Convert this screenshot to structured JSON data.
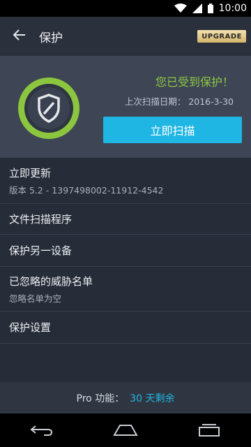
{
  "status_bar": {
    "time": "10:00",
    "icons": [
      "wifi-icon",
      "signal-icon",
      "battery-icon"
    ]
  },
  "app_bar": {
    "title": "保护",
    "upgrade_label": "UPGRADE",
    "back_icon": "back-arrow-icon"
  },
  "hero": {
    "status_title": "您已受到保护！",
    "last_scan": "上次扫描日期： 2016-3-30",
    "scan_button": "立即扫描",
    "badge_icon": "shield-icon"
  },
  "menu": [
    {
      "title": "立即更新",
      "subtitle": "版本 5.2 - 1397498002-11912-4542"
    },
    {
      "title": "文件扫描程序",
      "subtitle": ""
    },
    {
      "title": "保护另一设备",
      "subtitle": ""
    },
    {
      "title": "已忽略的威胁名单",
      "subtitle": "忽略名单为空"
    },
    {
      "title": "保护设置",
      "subtitle": ""
    }
  ],
  "footer": {
    "pro_label": "Pro 功能：",
    "days_left": "30 天剩余"
  },
  "colors": {
    "accent": "#1fb6e3",
    "protected_green": "#8cc63f",
    "background": "#262c38",
    "hero_bg": "#3e4656"
  }
}
